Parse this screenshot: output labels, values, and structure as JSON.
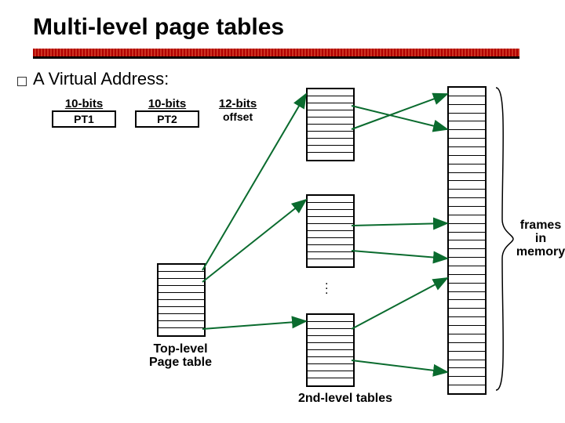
{
  "title": "Multi-level page tables",
  "subtitle": "A Virtual Address:",
  "fields": [
    {
      "bits": "10-bits",
      "name": "PT1",
      "boxed": true
    },
    {
      "bits": "10-bits",
      "name": "PT2",
      "boxed": true
    },
    {
      "bits": "12-bits",
      "name": "offset",
      "boxed": false
    }
  ],
  "labels": {
    "top_level": "Top-level\nPage table",
    "second_level": "2nd-level tables",
    "frames": "frames\nin\nmemory"
  },
  "layout": {
    "top_table_rows": 10,
    "second_level_tables": 3,
    "second_level_rows_each": 10,
    "frame_rows": 36
  },
  "arrows_color": "#0a6b2e"
}
